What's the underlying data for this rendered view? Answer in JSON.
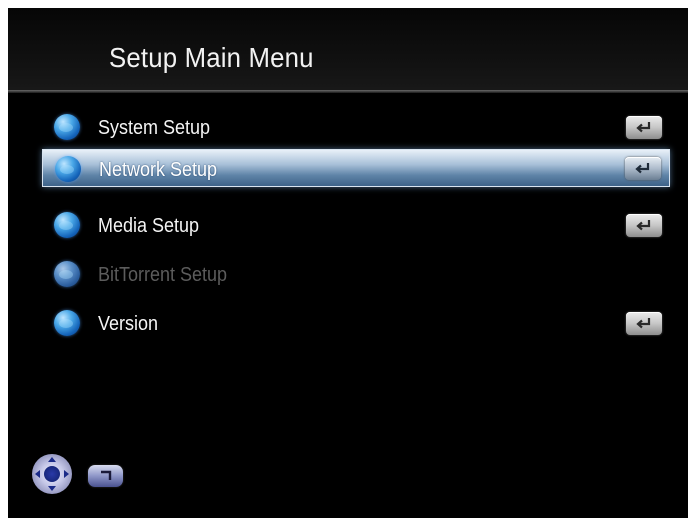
{
  "header": {
    "title": "Setup Main Menu"
  },
  "menu": {
    "items": [
      {
        "label": "System Setup",
        "icon": "globe-icon",
        "enter_icon": "enter-key-icon",
        "state": "normal"
      },
      {
        "label": "Network Setup",
        "icon": "globe-icon",
        "enter_icon": "enter-key-icon",
        "state": "selected"
      },
      {
        "label": "Media Setup",
        "icon": "globe-icon",
        "enter_icon": "enter-key-icon",
        "state": "normal"
      },
      {
        "label": "BitTorrent Setup",
        "icon": "globe-icon",
        "enter_icon": null,
        "state": "disabled"
      },
      {
        "label": "Version",
        "icon": "globe-icon",
        "enter_icon": "enter-key-icon",
        "state": "normal"
      }
    ]
  },
  "footer": {
    "nav_icon": "dpad-ok-icon",
    "return_icon": "return-icon"
  },
  "colors": {
    "background": "#000000",
    "text": "#f4f4f4",
    "disabled_text": "#5c5c5c",
    "highlight_top": "#e8f0f8",
    "highlight_bottom": "#3d6288",
    "globe": "#1362b8"
  }
}
